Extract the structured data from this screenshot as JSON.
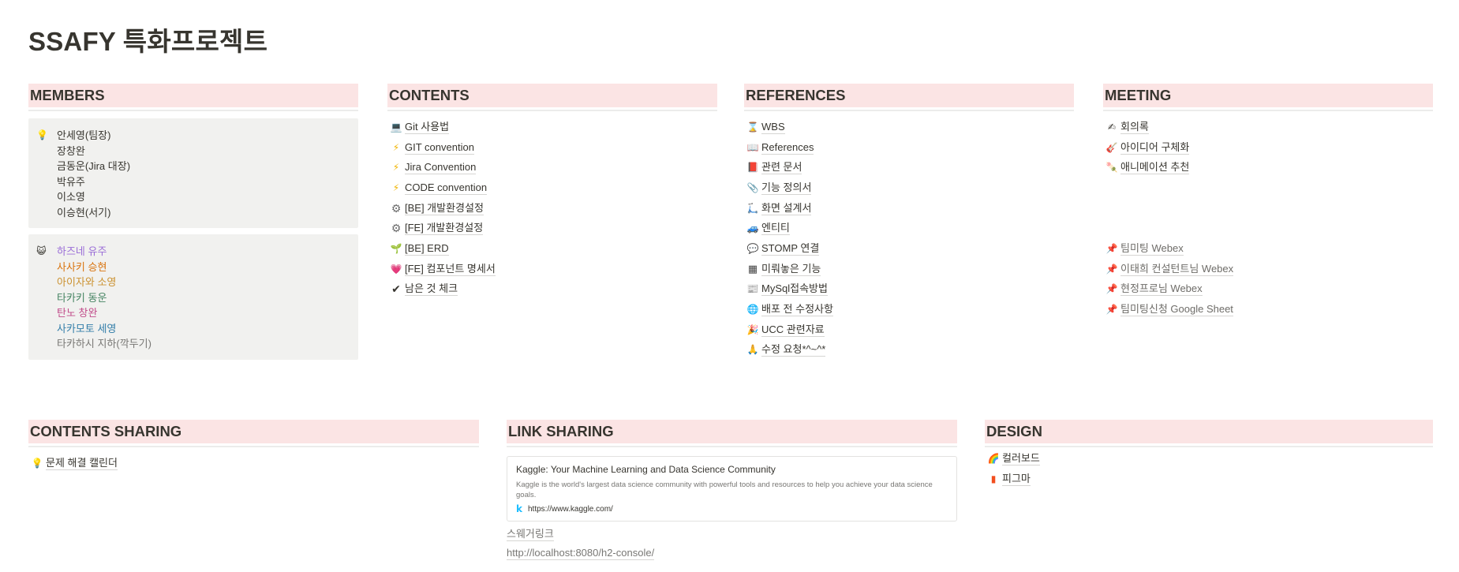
{
  "page": {
    "title": "SSAFY 특화프로젝트"
  },
  "members": {
    "heading": "MEMBERS",
    "callout1": {
      "icon": "lightbulb-icon",
      "glyph": "💡",
      "lines": [
        "안세영(팀장)",
        "장창완",
        "금동운(Jira 대장)",
        "박유주",
        "이소영",
        "이승현(서기)"
      ]
    },
    "callout2": {
      "icon": "cat-face-icon",
      "glyph": "😺",
      "lines": [
        {
          "text": "하즈네 유주",
          "color": "#9a6dd7"
        },
        {
          "text": "사사키 승현",
          "color": "#d9730d"
        },
        {
          "text": "아이자와 소영",
          "color": "#cb912f"
        },
        {
          "text": "타카키 동운",
          "color": "#448361"
        },
        {
          "text": "탄노 창완",
          "color": "#c14c8a"
        },
        {
          "text": "사카모토 세영",
          "color": "#337ea9"
        },
        {
          "text": "타카하시 지하(깍두기)",
          "color": "#787774"
        }
      ]
    }
  },
  "contents": {
    "heading": "CONTENTS",
    "items": [
      {
        "label": "Git 사용법",
        "icon": "laptop-icon",
        "glyph": "💻"
      },
      {
        "label": "GIT convention",
        "icon": "lightning-icon",
        "glyph": "⚡"
      },
      {
        "label": "Jira Convention",
        "icon": "lightning-icon",
        "glyph": "⚡"
      },
      {
        "label": "CODE convention",
        "icon": "lightning-icon",
        "glyph": "⚡"
      },
      {
        "label": "[BE] 개발환경설정",
        "icon": "gear-icon",
        "glyph": "⚙"
      },
      {
        "label": "[FE] 개발환경설정",
        "icon": "gear-icon",
        "glyph": "⚙"
      },
      {
        "label": "[BE] ERD",
        "icon": "seedling-icon",
        "glyph": "🌱"
      },
      {
        "label": "[FE] 컴포넌트 명세서",
        "icon": "heart-icon",
        "glyph": "💗"
      },
      {
        "label": "남은 것 체크",
        "icon": "checkmark-icon",
        "glyph": "✔"
      }
    ]
  },
  "references": {
    "heading": "REFERENCES",
    "items": [
      {
        "label": "WBS",
        "icon": "hourglass-icon",
        "glyph": "⌛"
      },
      {
        "label": "References",
        "icon": "open-book-icon",
        "glyph": "📖"
      },
      {
        "label": "관련 문서",
        "icon": "book-icon",
        "glyph": "📕"
      },
      {
        "label": "기능 정의서",
        "icon": "paperclip-icon",
        "glyph": "📎"
      },
      {
        "label": "화면 설계서",
        "icon": "scooter-icon",
        "glyph": "🛴"
      },
      {
        "label": "엔티티",
        "icon": "car-icon",
        "glyph": "🚙"
      },
      {
        "label": "STOMP 연결",
        "icon": "speech-bubble-icon",
        "glyph": "💬"
      },
      {
        "label": "미뤄놓은 기능",
        "icon": "grid-icon",
        "glyph": "▦"
      },
      {
        "label": "MySql접속방법",
        "icon": "newspaper-icon",
        "glyph": "📰"
      },
      {
        "label": "배포 전 수정사항",
        "icon": "globe-icon",
        "glyph": "🌐"
      },
      {
        "label": "UCC 관련자료",
        "icon": "party-popper-icon",
        "glyph": "🎉"
      },
      {
        "label": "수정 요청*^~^*",
        "icon": "prayer-hands-icon",
        "glyph": "🙏"
      }
    ]
  },
  "meeting": {
    "heading": "MEETING",
    "items": [
      {
        "label": "회의록",
        "icon": "pencil-icon",
        "glyph": "✍"
      },
      {
        "label": "아이디어 구체화",
        "icon": "guitar-icon",
        "glyph": "🎸"
      },
      {
        "label": "애니메이션 추천",
        "icon": "rice-cracker-icon",
        "glyph": "🍡"
      }
    ],
    "links": [
      {
        "label": "팀미팅 Webex",
        "icon": "pushpin-icon",
        "glyph": "📌"
      },
      {
        "label": "이태희 컨설턴트님 Webex",
        "icon": "pushpin-icon",
        "glyph": "📌"
      },
      {
        "label": "현정프로님 Webex",
        "icon": "pushpin-icon",
        "glyph": "📌"
      },
      {
        "label": "팀미팅신청 Google Sheet",
        "icon": "pushpin-icon",
        "glyph": "📌"
      }
    ]
  },
  "contents_sharing": {
    "heading": "CONTENTS SHARING",
    "items": [
      {
        "label": "문제 해결 캘린더",
        "icon": "lightbulb-icon",
        "glyph": "💡"
      }
    ]
  },
  "link_sharing": {
    "heading": "LINK SHARING",
    "bookmark": {
      "title": "Kaggle: Your Machine Learning and Data Science Community",
      "description": "Kaggle is the world's largest data science community with powerful tools and resources to help you achieve your data science goals.",
      "favicon": "kaggle-icon",
      "favicon_glyph": "k",
      "url": "https://www.kaggle.com/"
    },
    "links": [
      "스웨거링크",
      "http://localhost:8080/h2-console/"
    ]
  },
  "design": {
    "heading": "DESIGN",
    "items": [
      {
        "label": "컬러보드",
        "icon": "rainbow-icon",
        "glyph": "🌈"
      },
      {
        "label": "피그마",
        "icon": "figma-icon",
        "glyph": "▮"
      }
    ]
  }
}
